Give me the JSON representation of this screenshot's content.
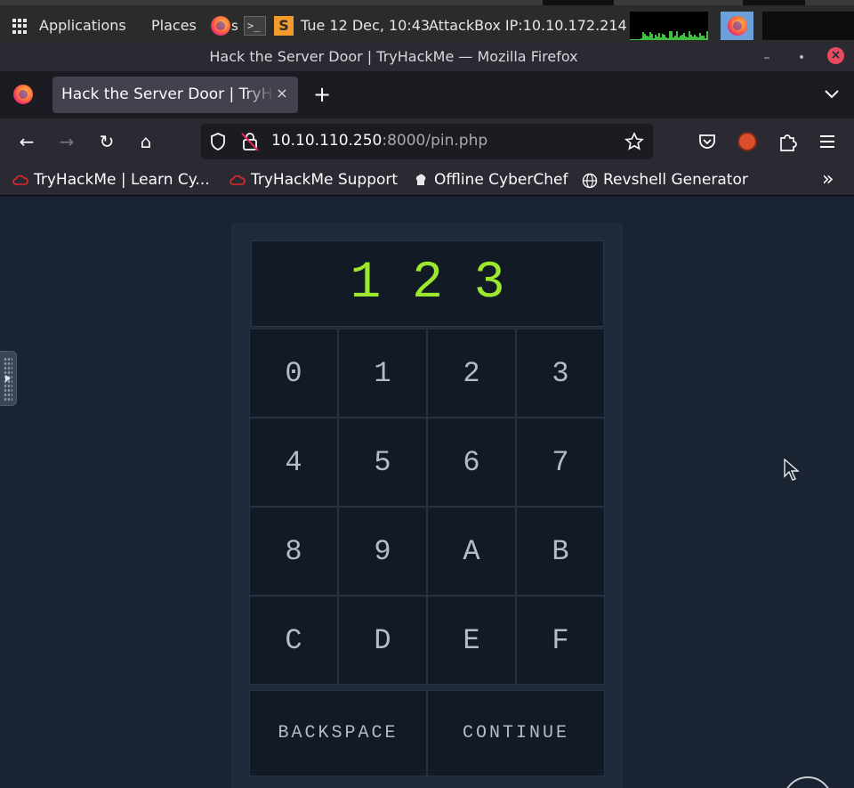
{
  "system_panel": {
    "applications": "Applications",
    "places": "Places",
    "task_label": "s   n",
    "clock": "Tue 12 Dec, 10:43",
    "attackbox": "AttackBox IP:10.10.172.214",
    "terminal_glyph": ">_",
    "sublime_glyph": "S"
  },
  "window": {
    "title": "Hack the Server Door | TryHackMe — Mozilla Firefox",
    "minimize": "–",
    "maximize": "•",
    "close": "×"
  },
  "tabs": {
    "active_label": "Hack the Server Door | TryHackMe",
    "close_glyph": "×",
    "new_tab_glyph": "+"
  },
  "navbar": {
    "back": "←",
    "forward": "→",
    "reload": "↻",
    "home": "⌂",
    "url_host": "10.10.110.250",
    "url_rest": ":8000/pin.php"
  },
  "bookmarks": [
    {
      "label": "TryHackMe | Learn Cy..."
    },
    {
      "label": "TryHackMe Support"
    },
    {
      "label": "Offline CyberChef"
    },
    {
      "label": "Revshell Generator"
    }
  ],
  "bookmarks_overflow": "»",
  "pinpad": {
    "entered": "1 2 3",
    "keys": [
      "0",
      "1",
      "2",
      "3",
      "4",
      "5",
      "6",
      "7",
      "8",
      "9",
      "A",
      "B",
      "C",
      "D",
      "E",
      "F"
    ],
    "backspace": "BACKSPACE",
    "continue": "CONTINUE"
  },
  "colors": {
    "page_bg": "#1a2332",
    "display_text": "#9be82e",
    "key_bg": "#121a26",
    "key_text": "#b4bcc8"
  }
}
